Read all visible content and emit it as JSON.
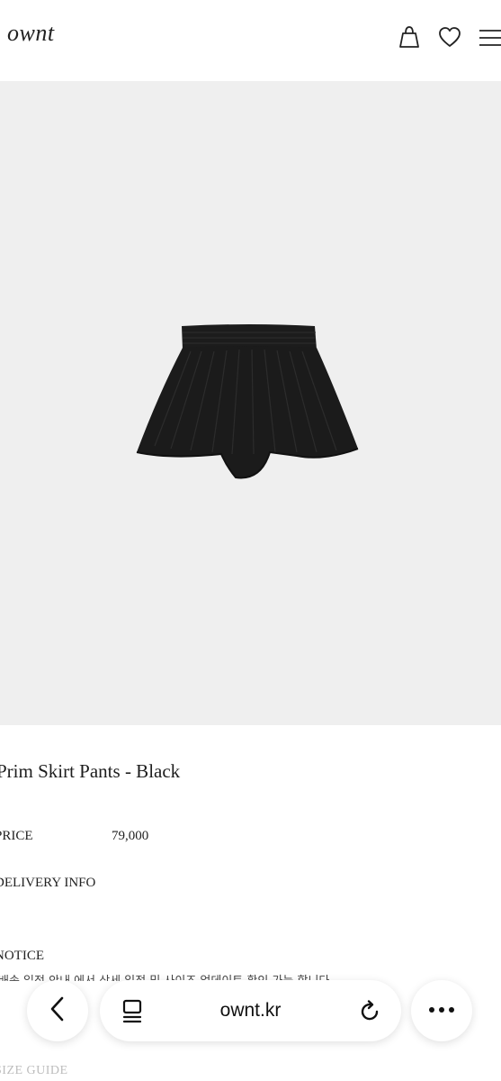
{
  "header": {
    "logo": "ownt",
    "icons": [
      "shopping-bag-icon",
      "heart-icon",
      "menu-icon"
    ]
  },
  "product": {
    "name": "Prim Skirt Pants - Black",
    "price_label": "PRICE",
    "price_value": "79,000",
    "delivery_label": "DELIVERY INFO",
    "notice_label": "NOTICE",
    "notice_text": "배송 일정 안내 에서 상세 일정 및 사이즈 업데이트 확인 가능 합니다",
    "size_guide_label": "SIZE GUIDE"
  },
  "browser": {
    "url": "ownt.kr",
    "icons": [
      "back-icon",
      "tabs-icon",
      "reload-icon",
      "more-icon"
    ]
  },
  "colors": {
    "hero_background": "#efefef",
    "garment": "#1b1b1b"
  }
}
